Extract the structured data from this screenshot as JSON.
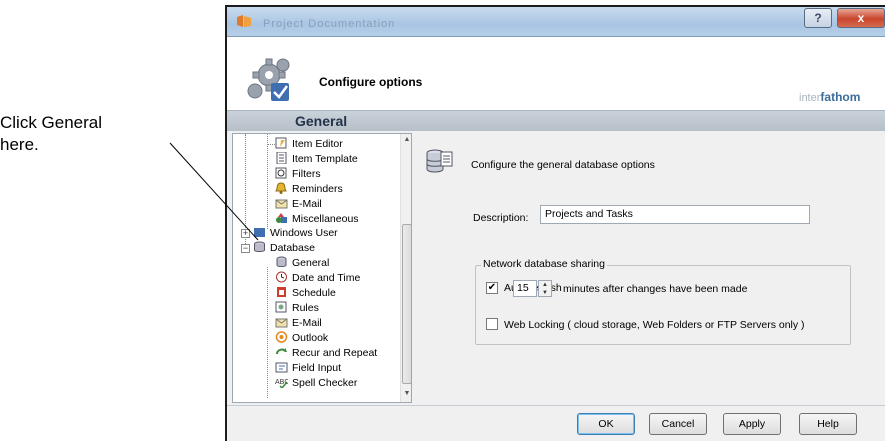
{
  "callout": {
    "text": "Click General\nhere."
  },
  "window": {
    "titlebar_blur_text": "Project    Documentation",
    "help_button": "?",
    "close_button": "x"
  },
  "header": {
    "title": "Configure options",
    "brand_light": "inter",
    "brand_bold": "fathom"
  },
  "section": {
    "title": "General"
  },
  "tree": {
    "items": [
      {
        "label": "Item Editor",
        "icon": "item-editor-icon"
      },
      {
        "label": "Item Template",
        "icon": "item-template-icon"
      },
      {
        "label": "Filters",
        "icon": "filters-icon"
      },
      {
        "label": "Reminders",
        "icon": "reminders-icon"
      },
      {
        "label": "E-Mail",
        "icon": "email-icon"
      },
      {
        "label": "Miscellaneous",
        "icon": "miscellaneous-icon"
      },
      {
        "label": "Windows User",
        "icon": "windows-user-icon"
      },
      {
        "label": "Database",
        "icon": "database-icon"
      },
      {
        "label": "General",
        "icon": "general-icon"
      },
      {
        "label": "Date and Time",
        "icon": "date-time-icon"
      },
      {
        "label": "Schedule",
        "icon": "schedule-icon"
      },
      {
        "label": "Rules",
        "icon": "rules-icon"
      },
      {
        "label": "E-Mail",
        "icon": "email-icon"
      },
      {
        "label": "Outlook",
        "icon": "outlook-icon"
      },
      {
        "label": "Recur and Repeat",
        "icon": "recur-icon"
      },
      {
        "label": "Field Input",
        "icon": "field-input-icon"
      },
      {
        "label": "Spell Checker",
        "icon": "spell-checker-icon"
      }
    ]
  },
  "content": {
    "description_heading": "Configure the general database options",
    "description_label": "Description:",
    "description_value": "Projects and Tasks",
    "group_title": "Network database sharing",
    "auto_refresh_label": "Auto-refresh",
    "auto_refresh_checked": "✔",
    "auto_refresh_value": "15",
    "auto_refresh_suffix": "minutes after changes have been made",
    "web_locking_label": "Web Locking ( cloud storage, Web Folders or FTP Servers only )",
    "web_locking_checked": false
  },
  "footer": {
    "ok": "OK",
    "cancel": "Cancel",
    "apply": "Apply",
    "help": "Help"
  },
  "colors": {
    "titlebar": "#b6cfe8",
    "section_bar": "#c0c8d0",
    "close_button": "#c9452c",
    "brand_accent": "#3c6c9c"
  }
}
